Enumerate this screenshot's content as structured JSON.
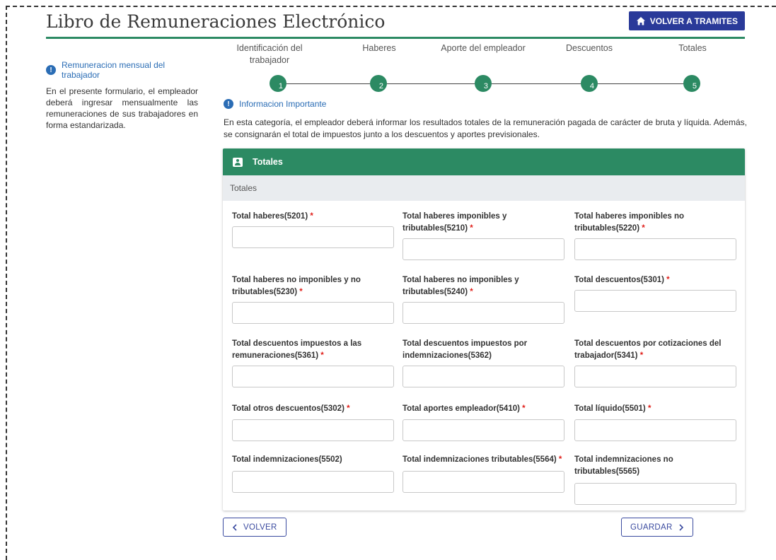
{
  "header": {
    "title": "Libro de Remuneraciones Electrónico",
    "back_button": "VOLVER A TRAMITES"
  },
  "sidebar": {
    "info_title": "Remuneracion mensual del trabajador",
    "text": "En el presente formulario, el empleador deberá ingresar mensualmente las remuneraciones de sus trabajadores en forma estandarizada."
  },
  "steps": [
    {
      "label": "Identificación del trabajador",
      "number": "1"
    },
    {
      "label": "Haberes",
      "number": "2"
    },
    {
      "label": "Aporte del empleador",
      "number": "3"
    },
    {
      "label": "Descuentos",
      "number": "4"
    },
    {
      "label": "Totales",
      "number": "5"
    }
  ],
  "info_important": {
    "title": "Informacion Importante",
    "text": "En esta categoría, el empleador deberá informar los resultados totales de la remuneración pagada de carácter de bruta y líquida. Además, se consignarán el total de impuestos junto a los descuentos y aportes previsionales."
  },
  "card": {
    "title": "Totales",
    "subtitle": "Totales",
    "fields": [
      {
        "label": "Total haberes(5201)",
        "required": "*",
        "value": ""
      },
      {
        "label": "Total haberes imponibles y tributables(5210)",
        "required": "*",
        "value": ""
      },
      {
        "label": "Total haberes imponibles no tributables(5220)",
        "required": "*",
        "value": ""
      },
      {
        "label": "Total haberes no imponibles y no tributables(5230)",
        "required": "*",
        "value": ""
      },
      {
        "label": "Total haberes no imponibles y tributables(5240)",
        "required": "*",
        "value": ""
      },
      {
        "label": "Total descuentos(5301)",
        "required": "*",
        "value": ""
      },
      {
        "label": "Total descuentos impuestos a las remuneraciones(5361)",
        "required": "*",
        "value": ""
      },
      {
        "label": "Total descuentos impuestos por indemnizaciones(5362)",
        "required": "",
        "value": ""
      },
      {
        "label": "Total descuentos por cotizaciones del trabajador(5341)",
        "required": "*",
        "value": ""
      },
      {
        "label": "Total otros descuentos(5302)",
        "required": "*",
        "value": ""
      },
      {
        "label": "Total aportes empleador(5410)",
        "required": "*",
        "value": ""
      },
      {
        "label": "Total líquido(5501)",
        "required": "*",
        "value": ""
      },
      {
        "label": "Total indemnizaciones(5502)",
        "required": "",
        "value": ""
      },
      {
        "label": "Total indemnizaciones tributables(5564)",
        "required": "*",
        "value": ""
      },
      {
        "label": "Total indemnizaciones no tributables(5565)",
        "required": "",
        "value": ""
      }
    ]
  },
  "footer": {
    "back_label": "VOLVER",
    "save_label": "GUARDAR"
  },
  "colors": {
    "primary_green": "#2c8a63",
    "navy": "#2a3a99",
    "info_blue": "#2b6db5",
    "required_red": "#e0201b"
  },
  "icons": [
    "home-icon",
    "info-icon",
    "person-card-icon",
    "chevron-left-icon",
    "chevron-right-icon"
  ]
}
